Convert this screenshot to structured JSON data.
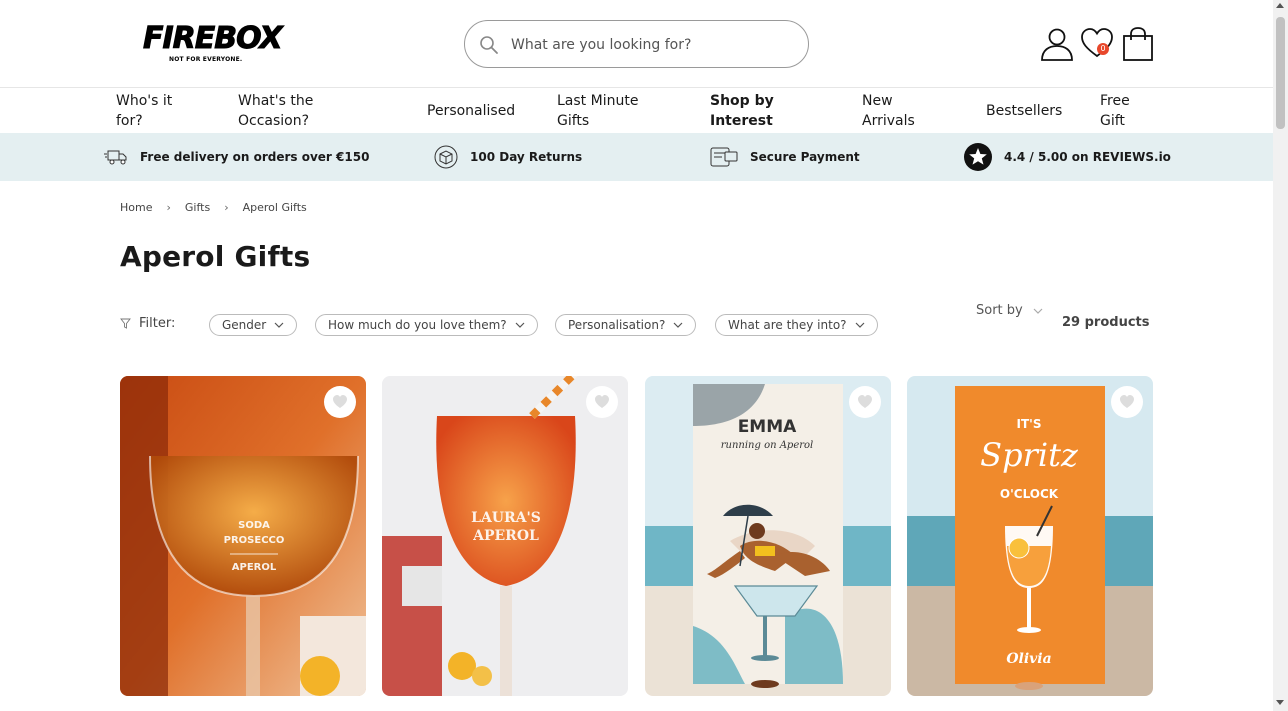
{
  "header": {
    "logo_text": "FIREBOX",
    "logo_tagline": "NOT FOR EVERYONE.",
    "search_placeholder": "What are you looking for?",
    "wishlist_count": "0"
  },
  "nav": [
    {
      "line1": "Who's it",
      "line2": "for?"
    },
    {
      "line1": "What's the",
      "line2": "Occasion?"
    },
    {
      "line1": "Personalised",
      "line2": ""
    },
    {
      "line1": "Last Minute",
      "line2": "Gifts"
    },
    {
      "line1": "Shop by",
      "line2": "Interest"
    },
    {
      "line1": "New",
      "line2": "Arrivals"
    },
    {
      "line1": "Bestsellers",
      "line2": ""
    },
    {
      "line1": "Free",
      "line2": "Gift"
    }
  ],
  "usp": [
    {
      "label": "Free delivery on orders over €150",
      "icon": "truck-icon"
    },
    {
      "label": "100 Day Returns",
      "icon": "box-return-icon"
    },
    {
      "label": "Secure Payment",
      "icon": "card-icon"
    },
    {
      "label": "4.4 / 5.00 on REVIEWS.io",
      "icon": "star-badge-icon"
    }
  ],
  "breadcrumb": [
    "Home",
    "Gifts",
    "Aperol Gifts"
  ],
  "page_title": "Aperol Gifts",
  "filters": {
    "label": "Filter:",
    "options": [
      "Gender",
      "How much do you love them?",
      "Personalisation?",
      "What are they into?"
    ],
    "sort_label": "Sort by",
    "count_label": "29 products"
  },
  "products": [
    {
      "glass_text": [
        "SODA",
        "PROSECCO",
        "APEROL"
      ]
    },
    {
      "glass_text": [
        "LAURA'S",
        "APEROL"
      ]
    },
    {
      "towel_text": [
        "EMMA",
        "running on Aperol"
      ]
    },
    {
      "towel_text": [
        "IT'S",
        "Spritz",
        "O'CLOCK",
        "Olivia"
      ]
    }
  ],
  "colors": {
    "usp_bg": "#e4eff1",
    "badge": "#e8472b",
    "towel_orange": "#f08a2c"
  }
}
